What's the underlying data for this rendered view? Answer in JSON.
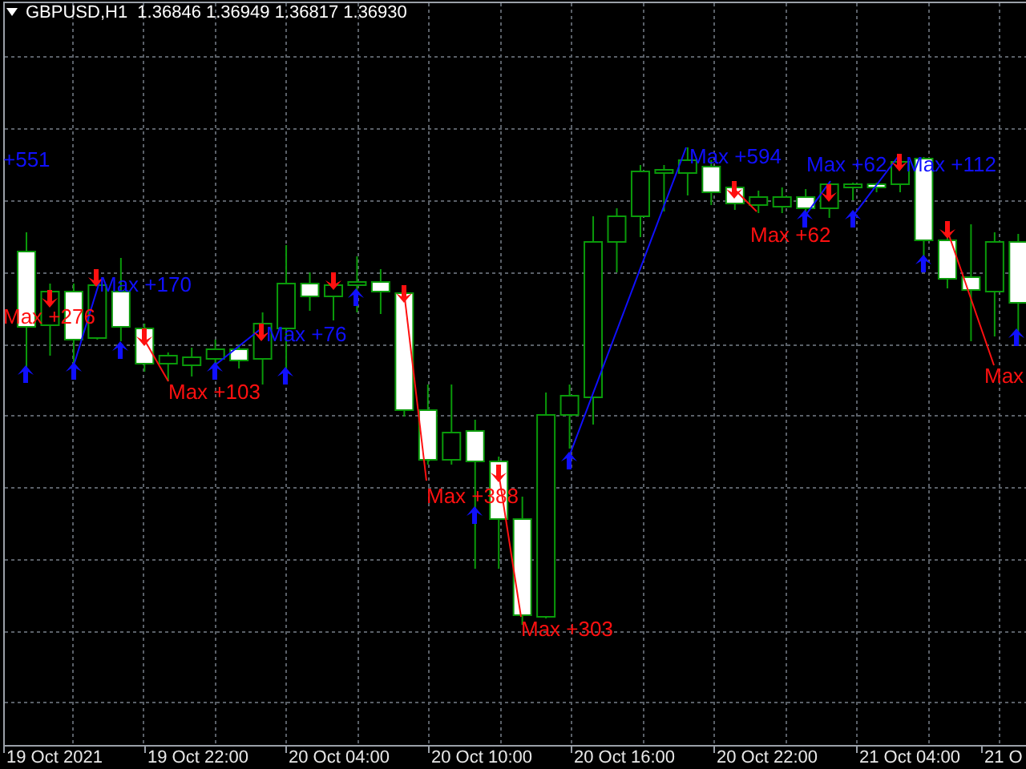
{
  "header": {
    "quote": "GBPUSD,H1  1.36846 1.36949 1.36817 1.36930"
  },
  "signals": [
    {
      "kind": "buy",
      "text": "+551"
    },
    {
      "kind": "sell",
      "text": "Max +276"
    },
    {
      "kind": "buy",
      "text": "Max +170"
    },
    {
      "kind": "buy",
      "text": "Max +76"
    },
    {
      "kind": "sell",
      "text": "Max +103"
    },
    {
      "kind": "sell",
      "text": "Max +388"
    },
    {
      "kind": "sell",
      "text": "Max +303"
    },
    {
      "kind": "buy",
      "text": "Max +594"
    },
    {
      "kind": "sell",
      "text": "Max +62"
    },
    {
      "kind": "buy",
      "text": "Max +62"
    },
    {
      "kind": "buy",
      "text": "Max +112"
    },
    {
      "kind": "sell",
      "text": "Max"
    }
  ],
  "time_axis": {
    "labels": [
      "19 Oct 2021",
      "19 Oct 22:00",
      "20 Oct 04:00",
      "20 Oct 10:00",
      "20 Oct 16:00",
      "20 Oct 22:00",
      "21 Oct 04:00",
      "21 O"
    ]
  }
}
